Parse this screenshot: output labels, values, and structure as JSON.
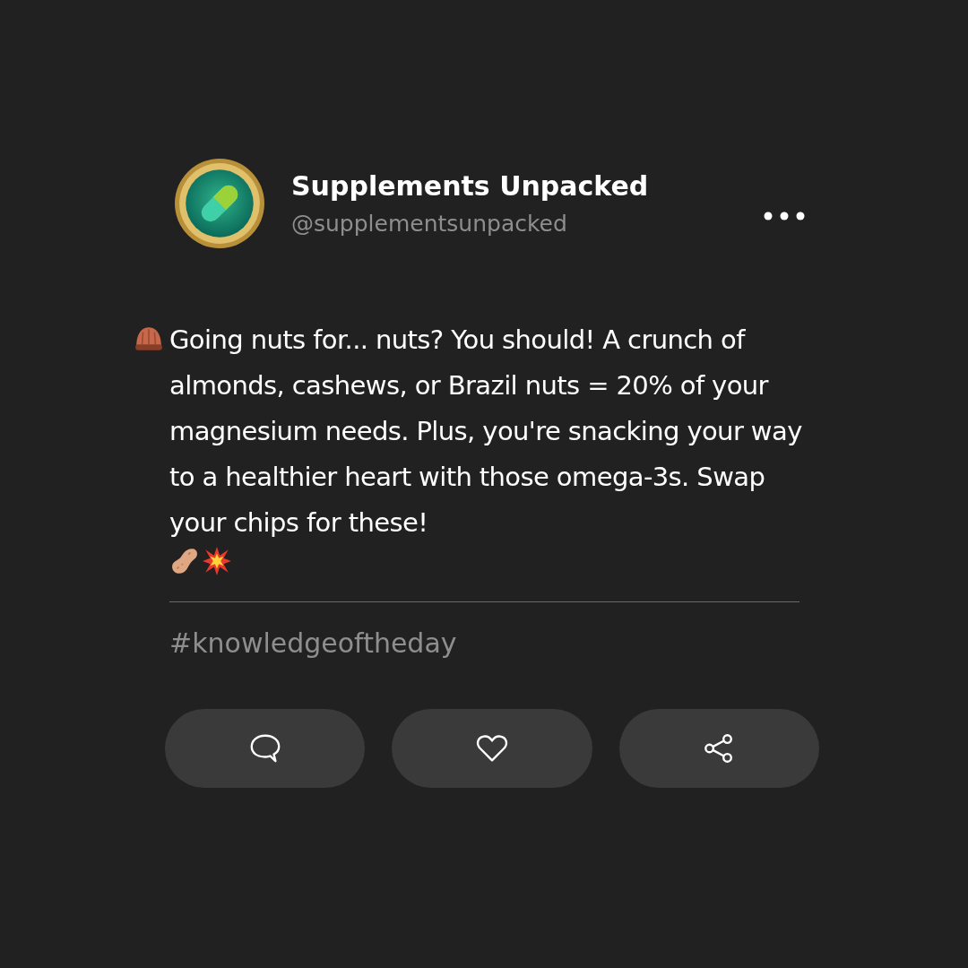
{
  "profile": {
    "name": "Supplements Unpacked",
    "handle": "@supplementsunpacked"
  },
  "post": {
    "text": "Going nuts for... nuts? You should! A crunch of almonds, cashews, or Brazil nuts = 20% of your magnesium needs. Plus, you're snacking your way to a healthier heart with those omega-3s. Swap your chips for these!",
    "hashtag": "#knowledgeoftheday"
  },
  "actions": [
    {
      "kind": "comment"
    },
    {
      "kind": "like"
    },
    {
      "kind": "share"
    }
  ]
}
